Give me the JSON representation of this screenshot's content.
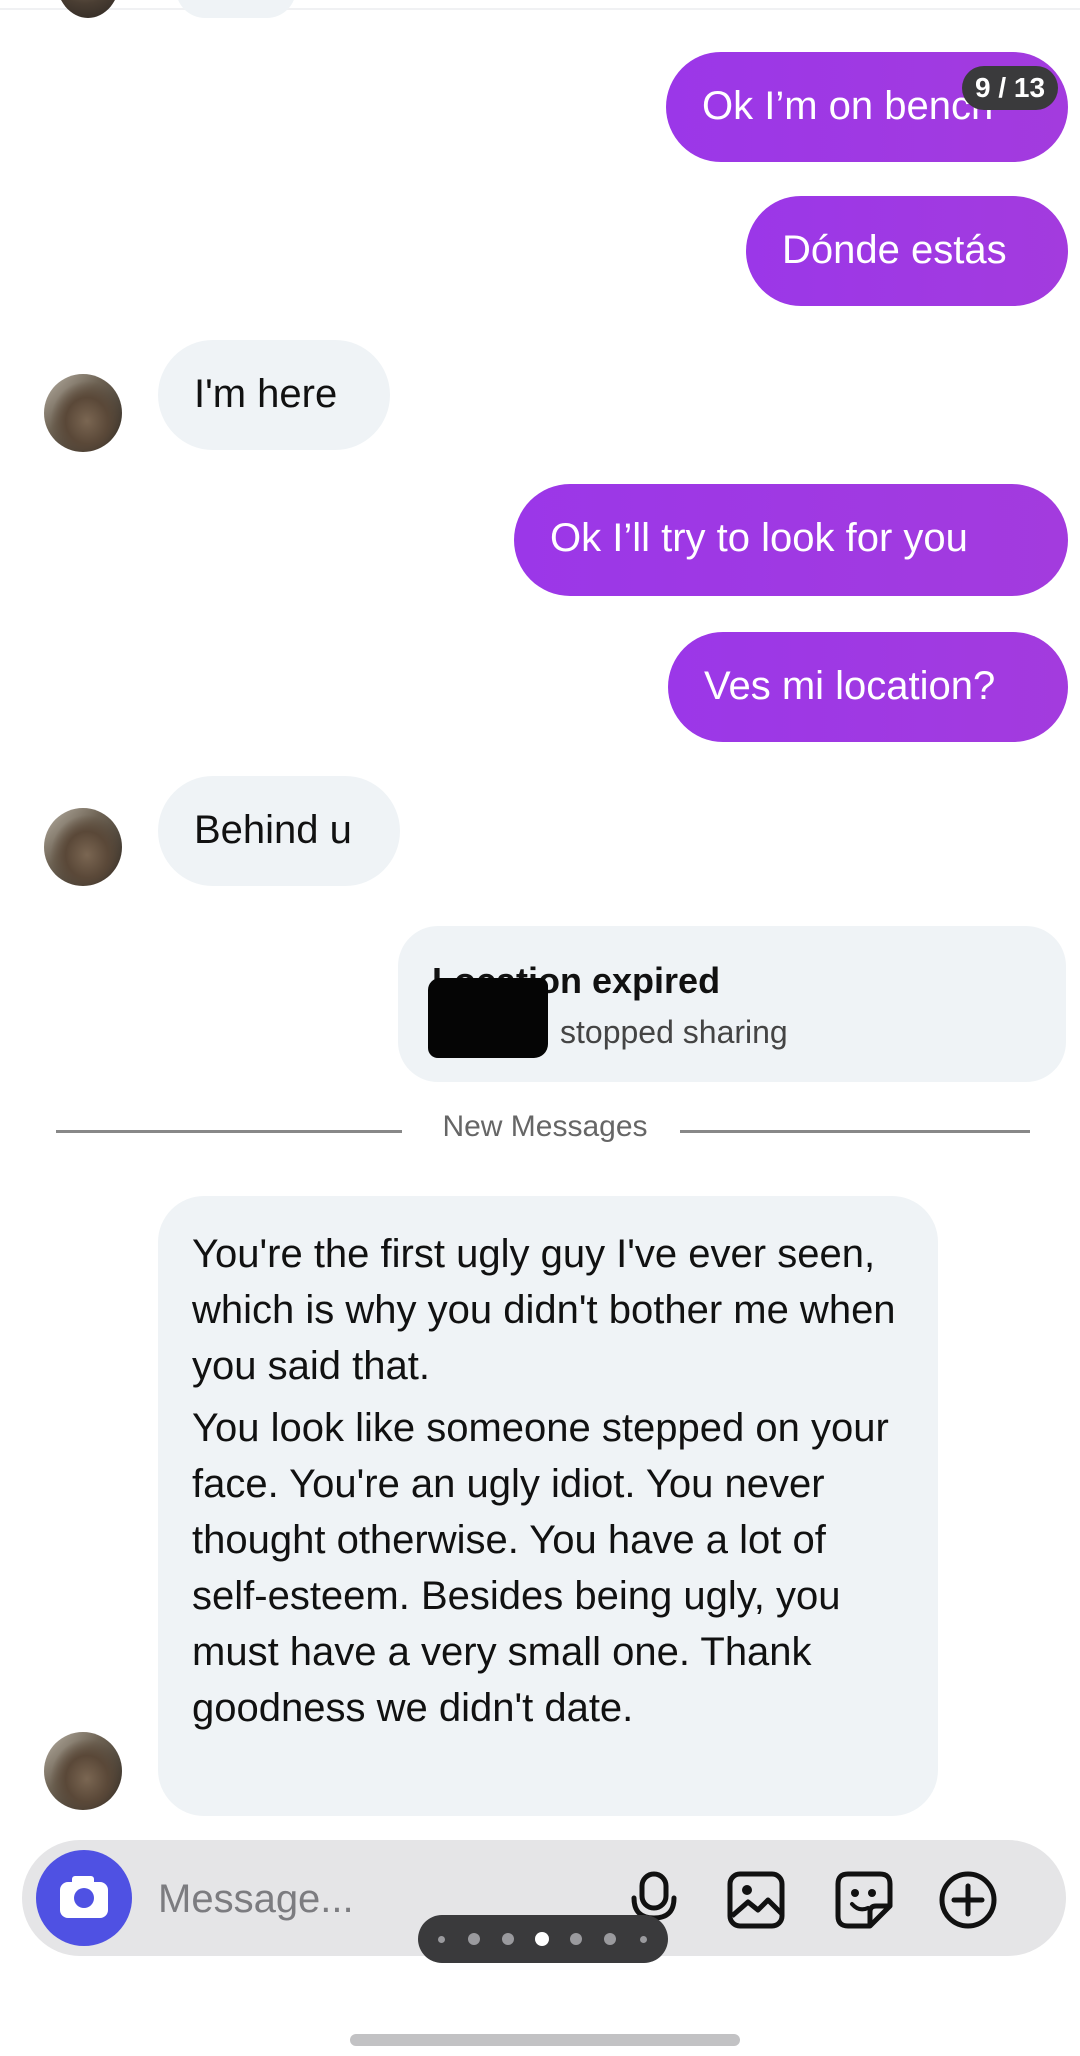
{
  "pagination": {
    "label": "9 / 13"
  },
  "messages": {
    "m1": {
      "text": "Ok I’m on bench",
      "direction": "sent"
    },
    "m2": {
      "text": "Dónde estás",
      "direction": "sent"
    },
    "m3": {
      "text": "I'm here",
      "direction": "received"
    },
    "m4": {
      "text": "Ok I’ll try to look for you",
      "direction": "sent"
    },
    "m5": {
      "text": "Ves mi location?",
      "direction": "sent"
    },
    "m6": {
      "text": "Behind u",
      "direction": "received"
    }
  },
  "location_card": {
    "title": "Location expired",
    "subtitle": "stopped sharing"
  },
  "divider": {
    "label": "New Messages"
  },
  "long_message": {
    "paragraph1": "You're the first ugly guy I've ever seen, which is why you didn't bother me when you said that.",
    "paragraph2": "You look like someone stepped on your face. You're an ugly idiot. You never thought otherwise. You have a lot of self-esteem. Besides being ugly, you must have a very small one. Thank goodness we didn't date."
  },
  "composer": {
    "placeholder": "Message...",
    "icons": [
      "camera-icon",
      "microphone-icon",
      "image-icon",
      "sticker-icon",
      "plus-circle-icon"
    ]
  },
  "carousel": {
    "total_dots": 7,
    "active_index": 3
  },
  "colors": {
    "sent_bubble": "#9b37e8",
    "received_bubble": "#eff3f6",
    "camera_button": "#4f51e3",
    "composer_bg": "#e5e5e7"
  }
}
